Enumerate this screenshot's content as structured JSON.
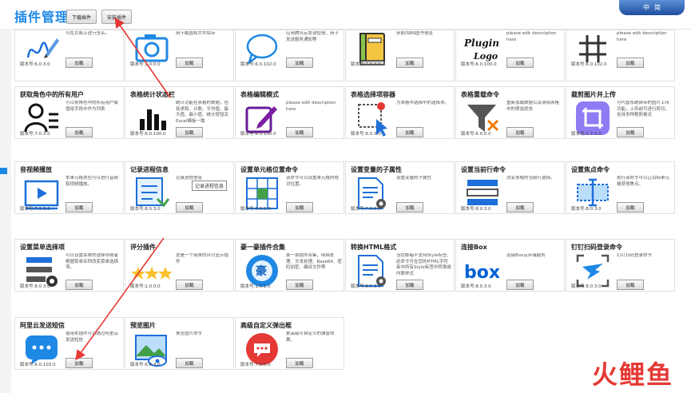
{
  "header": {
    "title": "插件管理",
    "download_btn": "下载插件",
    "install_btn": "安装插件",
    "lang_a": "中",
    "lang_b": "简"
  },
  "tooltip": "记录进程信息",
  "watermark": "火鲤鱼",
  "colors": {
    "accent": "#1e88e5",
    "arrow": "#e53935"
  },
  "load_label": "加载",
  "plugins": [
    {
      "title": "",
      "desc": "可在页面上进行签名。",
      "version": "版本号:6.0.3.0",
      "icon": "signature-pen-icon"
    },
    {
      "title": "",
      "desc": "用于截图和文件保存",
      "version": "版本号:1.0.0.0",
      "icon": "camera-icon"
    },
    {
      "title": "",
      "desc": "应用腾讯云发送短信，用于发送服务通知等",
      "version": "版本号:6.0.102.0",
      "icon": "speech-bubble-icon"
    },
    {
      "title": "",
      "desc": "获取ISBN图书信息",
      "version": "版本号:7.0.4.0",
      "icon": "book-icon"
    },
    {
      "title": "",
      "desc": "please edit description here",
      "version": "版本号:6.0.100.0",
      "icon": "plugin-logo-icon"
    },
    {
      "title": "",
      "desc": "please edit description here",
      "version": "版本号:6.0.102.0",
      "icon": "hash-icon"
    },
    {
      "title": "获取角色中的所有用户",
      "desc": "可以将角色中的所有用户赋值给字段中作为列表",
      "version": "版本号:7.0.3.0",
      "icon": "users-role-icon"
    },
    {
      "title": "表格统计状态栏",
      "desc": "统计功能在表格的数据，包括求和、计数、平均值、最大值、最小值、统计按钮及Excel模板一致",
      "version": "版本号:6.0.100.0",
      "icon": "bar-chart-icon"
    },
    {
      "title": "表格编辑模式",
      "desc": "please edit description here",
      "version": "版本号:6.0.100.0",
      "icon": "edit-mode-icon"
    },
    {
      "title": "表格选择项容器",
      "desc": "为表格中选择中的选择项。",
      "version": "版本号:8.0.3.0",
      "icon": "cursor-select-icon"
    },
    {
      "title": "表格重载命令",
      "desc": "重新加载数据以及清除表格中的筛选状态",
      "version": "版本号:6.0.0.0",
      "icon": "filter-reset-icon"
    },
    {
      "title": "裁剪图片并上传",
      "desc": "可代替系统自带的图片上传功能，上传前可进行剪切，支持多种裁剪格式",
      "version": "版本号:1.7.0.0",
      "icon": "crop-icon"
    },
    {
      "title": "音视频播放",
      "desc": "本单元格类型可以进行音频和视频播放。",
      "version": "版本号:7.0.3.0",
      "icon": "video-play-icon"
    },
    {
      "title": "记录进程信息",
      "desc": "记录进程信息",
      "version": "版本号:8.0.3.0",
      "icon": "process-log-icon"
    },
    {
      "title": "设置单元格位置命令",
      "desc": "该命令可以设置单元格的绝对位置。",
      "version": "版本号:6.0.3.0",
      "icon": "cell-position-icon"
    },
    {
      "title": "设置变量的子属性",
      "desc": "设置变量的子属性",
      "version": "版本号:7.0.0.0",
      "icon": "doc-settings-icon"
    },
    {
      "title": "设置当前行命令",
      "desc": "改变表格的当前行选择。",
      "version": "版本号:8.0.3.0",
      "icon": "current-row-icon"
    },
    {
      "title": "设置焦点命令",
      "desc": "执行该命令可以让目标单元格获得焦点。",
      "version": "版本号:8.0.3.0",
      "icon": "focus-cell-icon"
    },
    {
      "title": "设置菜单选择项",
      "desc": "可以设置菜单的选择项或者根据菜单名称改变菜单选择项。",
      "version": "版本号:8.0.3.0",
      "icon": "menu-settings-icon"
    },
    {
      "title": "评分插件",
      "desc": "这是一个简单的评分显示插件",
      "version": "版本号:1.0.0.0",
      "icon": "stars-icon"
    },
    {
      "title": "豪一豪插件合集",
      "desc": "豪一豪插件合集，网络处理、文本处理、Base64、密码加密、编译文件等",
      "version": "版本号:1.0.1.0",
      "icon": "hao-badge-icon"
    },
    {
      "title": "转换HTML格式",
      "desc": "当在邮箱不支持Style标签，此命令可在您的HTML字符串中所有Style标签中转换成内联样式",
      "version": "版本号:8.0.3.0",
      "icon": "doc-settings-icon"
    },
    {
      "title": "连接Box",
      "desc": "连接Box云存储服务",
      "version": "版本号:8.0.3.0",
      "icon": "box-logo-icon"
    },
    {
      "title": "钉钉扫码登录命令",
      "desc": "钉钉扫码登录命令",
      "version": "版本号:8.0.3.0",
      "icon": "dingtalk-scan-icon"
    },
    {
      "title": "阿里云发送短信",
      "desc": "使用本插件可以通过阿里云发送短信",
      "version": "版本号:6.0.103.0",
      "icon": "sms-bubble-icon"
    },
    {
      "title": "预览图片",
      "desc": "预览图片命令",
      "version": "版本号:6.0.3.0",
      "icon": "image-preview-icon"
    },
    {
      "title": "高级自定义弹出框",
      "desc": "更高级可自定义的弹窗效果。",
      "version": "版本号:7.0.0.0",
      "icon": "popup-chat-icon"
    }
  ]
}
